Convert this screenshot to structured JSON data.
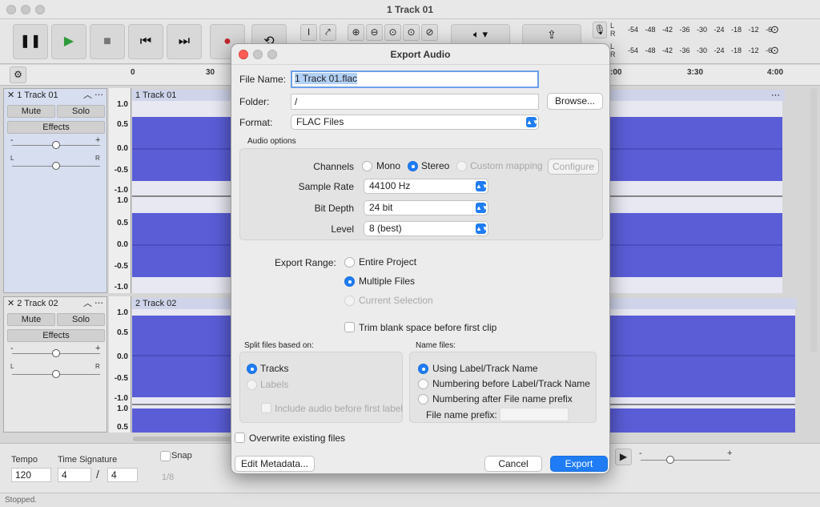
{
  "window": {
    "title": "1 Track 01"
  },
  "meters": {
    "record_lr": [
      "L",
      "R"
    ],
    "play_lr": [
      "L",
      "R"
    ],
    "scale": "-54 -48 -42 -36 -30 -24 -18 -12 -6"
  },
  "ruler": {
    "ticks": [
      "0",
      "30",
      ":00",
      "3:30",
      "4:00"
    ]
  },
  "tracks": [
    {
      "name": "1 Track 01",
      "clip_title": "1 Track 01",
      "mute": "Mute",
      "solo": "Solo",
      "effects": "Effects",
      "gain_minus": "-",
      "gain_plus": "+",
      "pan_left": "L",
      "pan_right": "R",
      "scale_upper": [
        "1.0",
        "0.5",
        "0.0",
        "-0.5",
        "-1.0"
      ],
      "scale_lower": [
        "1.0",
        "0.5",
        "0.0",
        "-0.5",
        "-1.0"
      ]
    },
    {
      "name": "2 Track 02",
      "clip_title": "2 Track 02",
      "mute": "Mute",
      "solo": "Solo",
      "effects": "Effects",
      "gain_minus": "-",
      "gain_plus": "+",
      "pan_left": "L",
      "pan_right": "R",
      "scale_upper": [
        "1.0",
        "0.5",
        "0.0",
        "-0.5",
        "-1.0"
      ],
      "scale_lower": [
        "1.0",
        "0.5"
      ]
    }
  ],
  "bottom": {
    "tempo_label": "Tempo",
    "tempo_value": "120",
    "time_sig_label": "Time Signature",
    "time_sig_num": "4",
    "time_sig_den": "4",
    "time_sig_sep": "/",
    "snap_label": "Snap",
    "snap_value": "1/8",
    "gain_minus": "-",
    "gain_plus": "+"
  },
  "status": {
    "text": "Stopped."
  },
  "dialog": {
    "title": "Export Audio",
    "file_name_label": "File Name:",
    "file_name_value": "1 Track 01.flac",
    "folder_label": "Folder:",
    "folder_value": "/",
    "browse_label": "Browse...",
    "format_label": "Format:",
    "format_value": "FLAC Files",
    "audio_options_label": "Audio options",
    "channels_label": "Channels",
    "channels_options": [
      "Mono",
      "Stereo",
      "Custom mapping"
    ],
    "channels_selected": "Stereo",
    "configure_label": "Configure",
    "sample_rate_label": "Sample Rate",
    "sample_rate_value": "44100 Hz",
    "bit_depth_label": "Bit Depth",
    "bit_depth_value": "24 bit",
    "level_label": "Level",
    "level_value": "8 (best)",
    "export_range_label": "Export Range:",
    "range_options": [
      "Entire Project",
      "Multiple Files",
      "Current Selection"
    ],
    "range_selected": "Multiple Files",
    "trim_label": "Trim blank space before first clip",
    "split_label": "Split files based on:",
    "split_options": [
      "Tracks",
      "Labels"
    ],
    "split_selected": "Tracks",
    "include_audio_label": "Include audio before first label",
    "name_files_label": "Name files:",
    "name_options": [
      "Using Label/Track Name",
      "Numbering before Label/Track Name",
      "Numbering after File name prefix"
    ],
    "name_selected": "Using Label/Track Name",
    "prefix_label": "File name prefix:",
    "prefix_value": "",
    "overwrite_label": "Overwrite existing files",
    "edit_metadata_label": "Edit Metadata...",
    "cancel_label": "Cancel",
    "export_label": "Export"
  }
}
